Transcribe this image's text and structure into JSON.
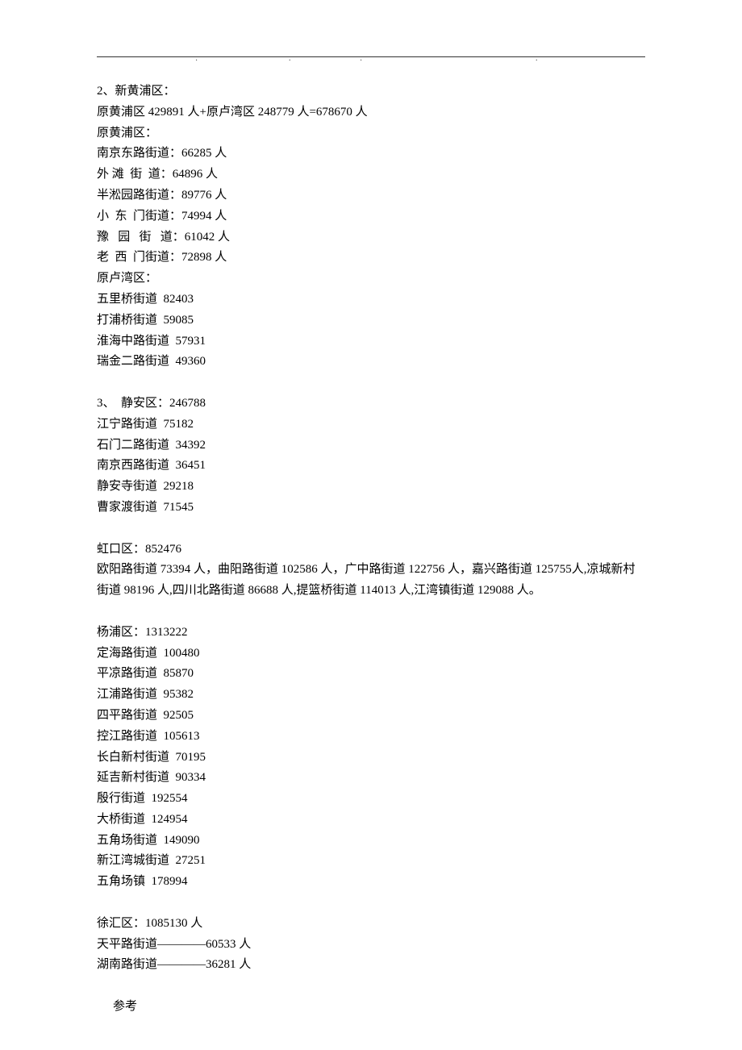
{
  "header_dots": [
    ".",
    ".",
    ".",
    "."
  ],
  "lines": [
    "2、新黄浦区：",
    "原黄浦区 429891 人+原卢湾区 248779 人=678670 人",
    "原黄浦区：",
    "南京东路街道：66285 人",
    "外 滩  街  道：64896 人",
    "半淞园路街道：89776 人",
    "小  东  门街道：74994 人",
    "豫   园   街   道：61042 人",
    "老  西  门街道：72898 人",
    "原卢湾区：",
    "五里桥街道  82403",
    "打浦桥街道  59085",
    "淮海中路街道  57931",
    "瑞金二路街道  49360",
    "",
    "3、  静安区：246788",
    "江宁路街道  75182",
    "石门二路街道  34392",
    "南京西路街道  36451",
    "静安寺街道  29218",
    "曹家渡街道  71545",
    "",
    "虹口区：852476",
    "欧阳路街道 73394 人，曲阳路街道 102586 人，广中路街道 122756 人，嘉兴路街道 125755人,凉城新村街道 98196 人,四川北路街道 86688 人,提篮桥街道 114013 人,江湾镇街道 129088 人。",
    "",
    "杨浦区：1313222",
    "定海路街道  100480",
    "平凉路街道  85870",
    "江浦路街道  95382",
    "四平路街道  92505",
    "控江路街道  105613",
    "长白新村街道  70195",
    "延吉新村街道  90334",
    "殷行街道  192554",
    "大桥街道  124954",
    "五角场街道  149090",
    "新江湾城街道  27251",
    "五角场镇  178994",
    "",
    "徐汇区：1085130 人",
    "天平路街道————60533 人",
    "湖南路街道————36281 人"
  ],
  "footer": "参考"
}
